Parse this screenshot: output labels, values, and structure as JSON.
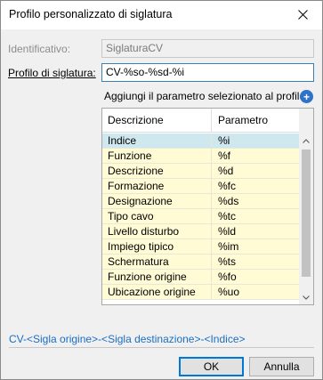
{
  "window": {
    "title": "Profilo personalizzato di siglatura",
    "close_icon": "close-icon"
  },
  "form": {
    "id_label": "Identificativo:",
    "id_value": "SiglaturaCV",
    "profile_label": "Profilo di siglatura:",
    "profile_value": "CV-%so-%sd-%i",
    "add_param_label": "Aggiungi il parametro selezionato al profilo:",
    "add_icon": "plus-circle-icon"
  },
  "grid": {
    "columns": [
      "Descrizione",
      "Parametro"
    ],
    "rows": [
      {
        "desc": "Indice",
        "param": "%i",
        "selected": true
      },
      {
        "desc": "Funzione",
        "param": "%f"
      },
      {
        "desc": "Descrizione",
        "param": "%d"
      },
      {
        "desc": "Formazione",
        "param": "%fc"
      },
      {
        "desc": "Designazione",
        "param": "%ds"
      },
      {
        "desc": "Tipo cavo",
        "param": "%tc"
      },
      {
        "desc": "Livello disturbo",
        "param": "%ld"
      },
      {
        "desc": "Impiego tipico",
        "param": "%im"
      },
      {
        "desc": "Schermatura",
        "param": "%ts"
      },
      {
        "desc": "Funzione origine",
        "param": "%fo"
      },
      {
        "desc": "Ubicazione origine",
        "param": "%uo"
      }
    ],
    "row_colors": {
      "normal": "#fffbd5",
      "selected": "#cfe8ef"
    }
  },
  "preview": {
    "text": "CV-<Sigla origine>-<Sigla destinazione>-<Indice>",
    "color": "#1a6fc4"
  },
  "buttons": {
    "ok": "OK",
    "cancel": "Annulla"
  }
}
